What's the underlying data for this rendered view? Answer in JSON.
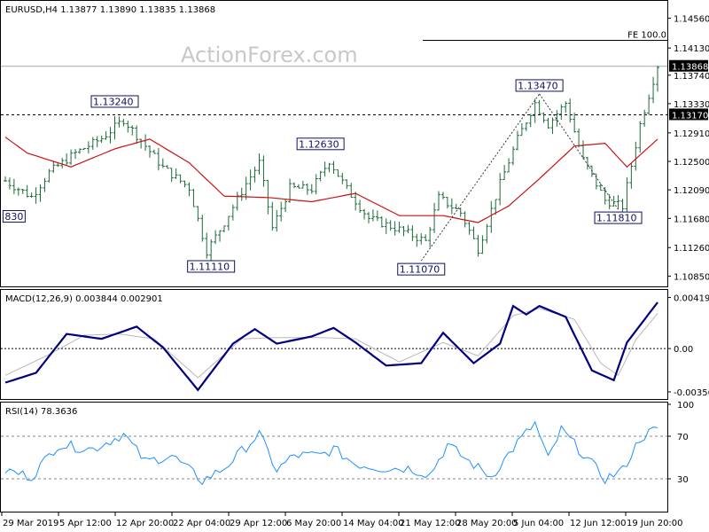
{
  "header": {
    "symbol_info": "EURUSD,H4  1.13877 1.13890 1.13835 1.13868",
    "watermark": "ActionForex.com"
  },
  "chart_data": [
    {
      "type": "line",
      "title": "EURUSD,H4",
      "ohlc_last": {
        "open": 1.13877,
        "high": 1.1389,
        "low": 1.13835,
        "close": 1.13868
      },
      "y_ticks": [
        "1.14560",
        "1.14130",
        "1.13740",
        "1.13330",
        "1.12910",
        "1.12500",
        "1.12090",
        "1.11680",
        "1.11260",
        "1.10850"
      ],
      "y_tick_values": [
        1.1456,
        1.1413,
        1.1374,
        1.1333,
        1.1291,
        1.125,
        1.1209,
        1.1168,
        1.1126,
        1.1085
      ],
      "ylim": [
        1.1074,
        1.1477
      ],
      "x_ticks": [
        "29 Mar 2019",
        "5 Apr 12:00",
        "12 Apr 20:00",
        "22 Apr 04:00",
        "29 Apr 12:00",
        "6 May 20:00",
        "14 May 04:00",
        "21 May 12:00",
        "28 May 20:00",
        "5 Jun 04:00",
        "12 Jun 12:00",
        "19 Jun 20:00"
      ],
      "price_line": {
        "value": 1.13868,
        "label": "1.13868"
      },
      "support_line": {
        "value": 1.1317,
        "label": "1.13170"
      },
      "fe_line": {
        "value": 1.1424,
        "label": "FE 100.0"
      },
      "annotations": [
        {
          "label": "1.13240",
          "bar": 25,
          "value": 1.1324
        },
        {
          "label": "1.12630",
          "bar": 72,
          "value": 1.1263
        },
        {
          "label": "1.11110",
          "bar": 47,
          "value": 1.1111
        },
        {
          "label": "1.11070",
          "bar": 95,
          "value": 1.1107
        },
        {
          "label": "1.13470",
          "bar": 122,
          "value": 1.1347
        },
        {
          "label": "1.11810",
          "bar": 140,
          "value": 1.1181
        },
        {
          "label": "830",
          "bar": 2,
          "value": 1.1183
        }
      ],
      "close_anchors": [
        [
          0,
          1.1222
        ],
        [
          6,
          1.1199
        ],
        [
          10,
          1.1234
        ],
        [
          16,
          1.1262
        ],
        [
          22,
          1.1283
        ],
        [
          27,
          1.131
        ],
        [
          31,
          1.128
        ],
        [
          36,
          1.1241
        ],
        [
          42,
          1.1212
        ],
        [
          46,
          1.1121
        ],
        [
          50,
          1.1162
        ],
        [
          55,
          1.1218
        ],
        [
          58,
          1.1248
        ],
        [
          61,
          1.1154
        ],
        [
          65,
          1.1212
        ],
        [
          70,
          1.121
        ],
        [
          74,
          1.1251
        ],
        [
          78,
          1.121
        ],
        [
          83,
          1.1168
        ],
        [
          90,
          1.1152
        ],
        [
          96,
          1.1135
        ],
        [
          99,
          1.1198
        ],
        [
          104,
          1.1176
        ],
        [
          108,
          1.1124
        ],
        [
          113,
          1.1218
        ],
        [
          117,
          1.1282
        ],
        [
          121,
          1.1334
        ],
        [
          124,
          1.1303
        ],
        [
          128,
          1.1334
        ],
        [
          132,
          1.1252
        ],
        [
          137,
          1.1194
        ],
        [
          141,
          1.1185
        ],
        [
          145,
          1.1303
        ],
        [
          149,
          1.1388
        ]
      ],
      "ema_anchors": [
        [
          0,
          1.1285
        ],
        [
          5,
          1.1262
        ],
        [
          15,
          1.1242
        ],
        [
          25,
          1.1268
        ],
        [
          33,
          1.1282
        ],
        [
          42,
          1.1248
        ],
        [
          50,
          1.12
        ],
        [
          60,
          1.1198
        ],
        [
          70,
          1.1192
        ],
        [
          80,
          1.1204
        ],
        [
          90,
          1.1172
        ],
        [
          100,
          1.1172
        ],
        [
          108,
          1.1162
        ],
        [
          115,
          1.1186
        ],
        [
          122,
          1.1225
        ],
        [
          130,
          1.1272
        ],
        [
          137,
          1.1276
        ],
        [
          142,
          1.1242
        ],
        [
          149,
          1.1282
        ]
      ]
    },
    {
      "type": "line",
      "title": "MACD(12,26,9) 0.003844 0.002901",
      "y_ticks": [
        "0.004196",
        "0.00",
        "-0.003563"
      ],
      "y_tick_values": [
        0.004196,
        0.0,
        -0.003563
      ],
      "ylim": [
        -0.004,
        0.0046
      ],
      "series": [
        {
          "name": "MACD",
          "anchors": [
            [
              0,
              -0.0028
            ],
            [
              7,
              -0.002
            ],
            [
              14,
              0.0012
            ],
            [
              22,
              0.0008
            ],
            [
              30,
              0.0018
            ],
            [
              36,
              0.0001
            ],
            [
              44,
              -0.0034
            ],
            [
              52,
              0.0004
            ],
            [
              57,
              0.0016
            ],
            [
              62,
              0.0004
            ],
            [
              70,
              0.001
            ],
            [
              75,
              0.0017
            ],
            [
              80,
              0.0005
            ],
            [
              87,
              -0.0014
            ],
            [
              95,
              -0.0012
            ],
            [
              100,
              0.0013
            ],
            [
              107,
              -0.0012
            ],
            [
              113,
              0.0004
            ],
            [
              116,
              0.0035
            ],
            [
              119,
              0.0028
            ],
            [
              122,
              0.0035
            ],
            [
              128,
              0.0026
            ],
            [
              134,
              -0.0018
            ],
            [
              139,
              -0.0026
            ],
            [
              142,
              0.0005
            ],
            [
              149,
              0.0038
            ]
          ]
        },
        {
          "name": "Signal",
          "anchors": [
            [
              0,
              -0.0022
            ],
            [
              10,
              -0.0005
            ],
            [
              18,
              0.0011
            ],
            [
              26,
              0.0012
            ],
            [
              34,
              0.0008
            ],
            [
              44,
              -0.0024
            ],
            [
              54,
              0.0008
            ],
            [
              62,
              0.0009
            ],
            [
              72,
              0.0009
            ],
            [
              80,
              0.0008
            ],
            [
              90,
              -0.0011
            ],
            [
              100,
              0.0005
            ],
            [
              108,
              -0.0006
            ],
            [
              116,
              0.0027
            ],
            [
              122,
              0.0033
            ],
            [
              130,
              0.0024
            ],
            [
              136,
              -0.0012
            ],
            [
              140,
              -0.0022
            ],
            [
              144,
              0.0007
            ],
            [
              149,
              0.0029
            ]
          ]
        }
      ]
    },
    {
      "type": "line",
      "title": "RSI(14) 78.3636",
      "y_ticks": [
        "100",
        "70",
        "30"
      ],
      "y_tick_values": [
        100,
        70,
        30
      ],
      "levels": [
        70,
        30
      ],
      "ylim": [
        0,
        100
      ],
      "series": [
        {
          "name": "RSI",
          "anchors": [
            [
              0,
              38
            ],
            [
              6,
              32
            ],
            [
              12,
              62
            ],
            [
              20,
              58
            ],
            [
              27,
              72
            ],
            [
              32,
              46
            ],
            [
              38,
              52
            ],
            [
              45,
              28
            ],
            [
              50,
              40
            ],
            [
              55,
              60
            ],
            [
              58,
              72
            ],
            [
              62,
              38
            ],
            [
              66,
              52
            ],
            [
              72,
              52
            ],
            [
              75,
              58
            ],
            [
              80,
              44
            ],
            [
              86,
              40
            ],
            [
              92,
              40
            ],
            [
              97,
              34
            ],
            [
              101,
              62
            ],
            [
              106,
              46
            ],
            [
              111,
              32
            ],
            [
              117,
              64
            ],
            [
              121,
              82
            ],
            [
              124,
              48
            ],
            [
              127,
              76
            ],
            [
              131,
              58
            ],
            [
              137,
              30
            ],
            [
              141,
              38
            ],
            [
              145,
              68
            ],
            [
              149,
              78
            ]
          ]
        }
      ]
    }
  ]
}
